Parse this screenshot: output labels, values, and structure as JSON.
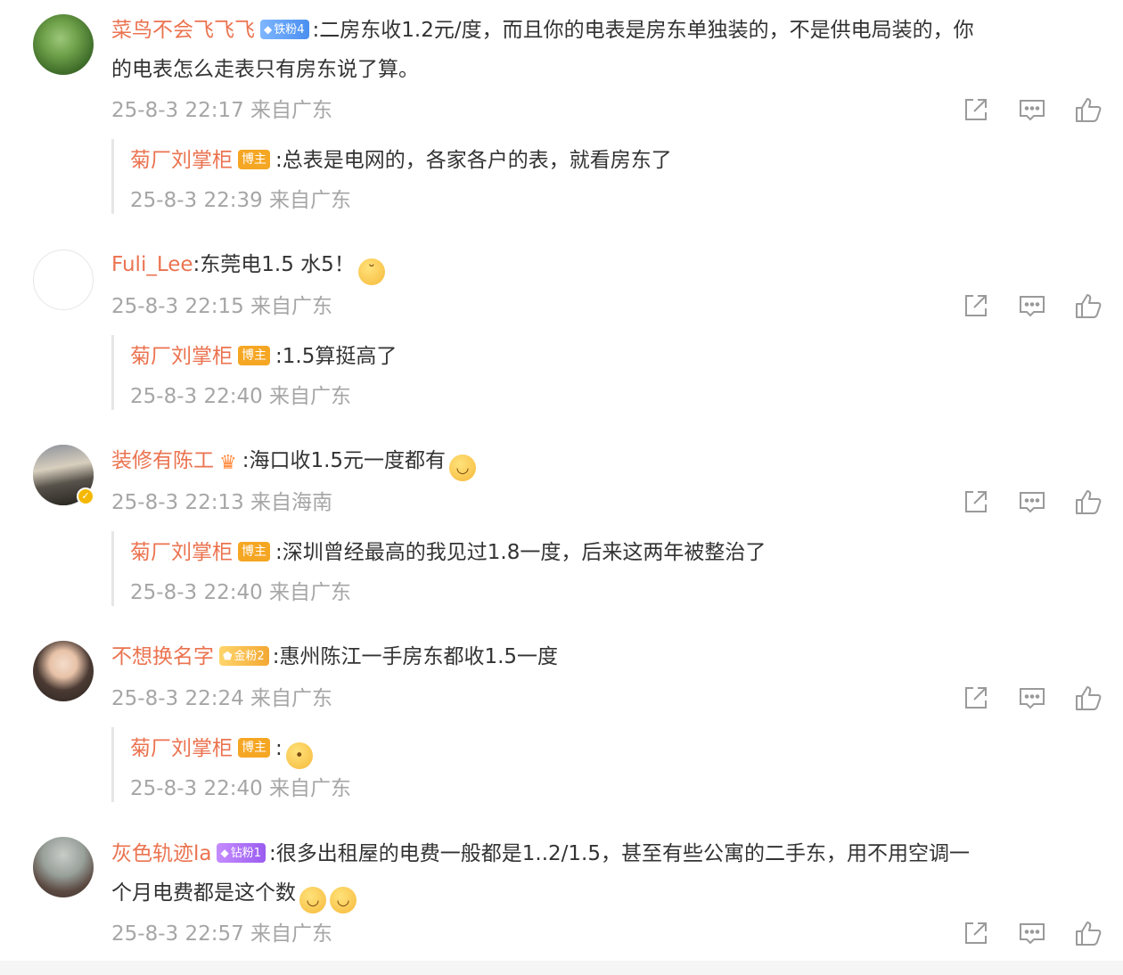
{
  "comments": [
    {
      "user": "菜鸟不会飞飞飞",
      "badge": "铁粉4",
      "text_line1": ":二房东收1.2元/度，而且你的电表是房东单独装的，不是供电局装的，你",
      "text_line2": "的电表怎么走表只有房东说了算。",
      "meta": "25-8-3 22:17 来自广东",
      "reply": {
        "user": "菊厂刘掌柜",
        "tag": "博主",
        "text": ":总表是电网的，各家各户的表，就看房东了",
        "meta": "25-8-3 22:39 来自广东"
      }
    },
    {
      "user": "Fuli_Lee",
      "text_line1": ":东莞电1.5 水5！",
      "meta": "25-8-3 22:15 来自广东",
      "reply": {
        "user": "菊厂刘掌柜",
        "tag": "博主",
        "text": ":1.5算挺高了",
        "meta": "25-8-3 22:40 来自广东"
      }
    },
    {
      "user": "装修有陈工",
      "text_line1": ":海口收1.5元一度都有",
      "meta": "25-8-3 22:13 来自海南",
      "reply": {
        "user": "菊厂刘掌柜",
        "tag": "博主",
        "text": ":深圳曾经最高的我见过1.8一度，后来这两年被整治了",
        "meta": "25-8-3 22:40 来自广东"
      }
    },
    {
      "user": "不想换名字",
      "badge": "金粉2",
      "text_line1": ":惠州陈江一手房东都收1.5一度",
      "meta": "25-8-3 22:24 来自广东",
      "reply": {
        "user": "菊厂刘掌柜",
        "tag": "博主",
        "text": ":",
        "meta": "25-8-3 22:40 来自广东"
      }
    },
    {
      "user": "灰色轨迹la",
      "badge": "钻粉1",
      "text_line1": ":很多出租屋的电费一般都是1..2/1.5，甚至有些公寓的二手东，用不用空调一",
      "text_line2": "个月电费都是这个数",
      "meta": "25-8-3 22:57 来自广东"
    }
  ],
  "icons": {
    "share": "share-icon",
    "comment": "comment-icon",
    "like": "like-icon"
  },
  "colors": {
    "name": "#eb7350",
    "meta": "#a6a6a6",
    "host_tag": "#f5a623"
  }
}
